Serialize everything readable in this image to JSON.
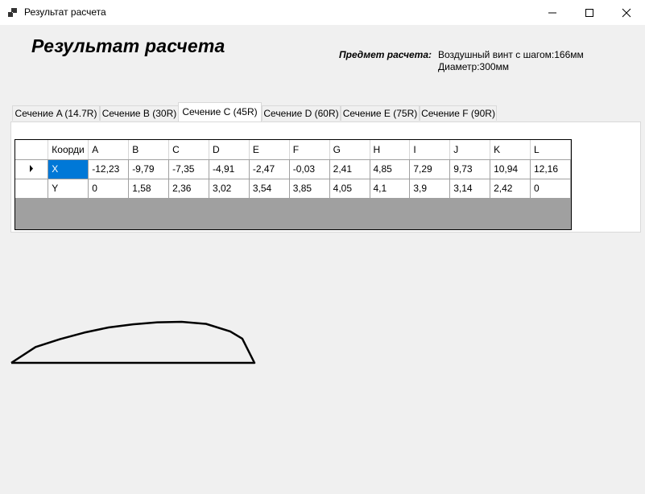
{
  "window": {
    "title": "Результат расчета"
  },
  "header": {
    "title": "Результат расчета",
    "subject_label": "Предмет расчета:",
    "subject_line1": "Воздушный винт с шагом:166мм",
    "subject_line2": "Диаметр:300мм"
  },
  "tabs": [
    {
      "label": "Сечение A (14.7R)"
    },
    {
      "label": "Сечение B (30R)"
    },
    {
      "label": "Сечение C (45R)"
    },
    {
      "label": "Сечение D (60R)"
    },
    {
      "label": "Сечение E (75R)"
    },
    {
      "label": "Сечение F (90R)"
    }
  ],
  "active_tab": 2,
  "grid": {
    "first_header": "Коорди",
    "columns": [
      "A",
      "B",
      "C",
      "D",
      "E",
      "F",
      "G",
      "H",
      "I",
      "J",
      "K",
      "L"
    ],
    "rows": [
      {
        "name": "X",
        "values": [
          "-12,23",
          "-9,79",
          "-7,35",
          "-4,91",
          "-2,47",
          "-0,03",
          "2,41",
          "4,85",
          "7,29",
          "9,73",
          "10,94",
          "12,16"
        ]
      },
      {
        "name": "Y",
        "values": [
          "0",
          "1,58",
          "2,36",
          "3,02",
          "3,54",
          "3,85",
          "4,05",
          "4,1",
          "3,9",
          "3,14",
          "2,42",
          "0"
        ]
      }
    ]
  },
  "colors": {
    "selection": "#0078d7",
    "grid_empty": "#a0a0a0"
  }
}
